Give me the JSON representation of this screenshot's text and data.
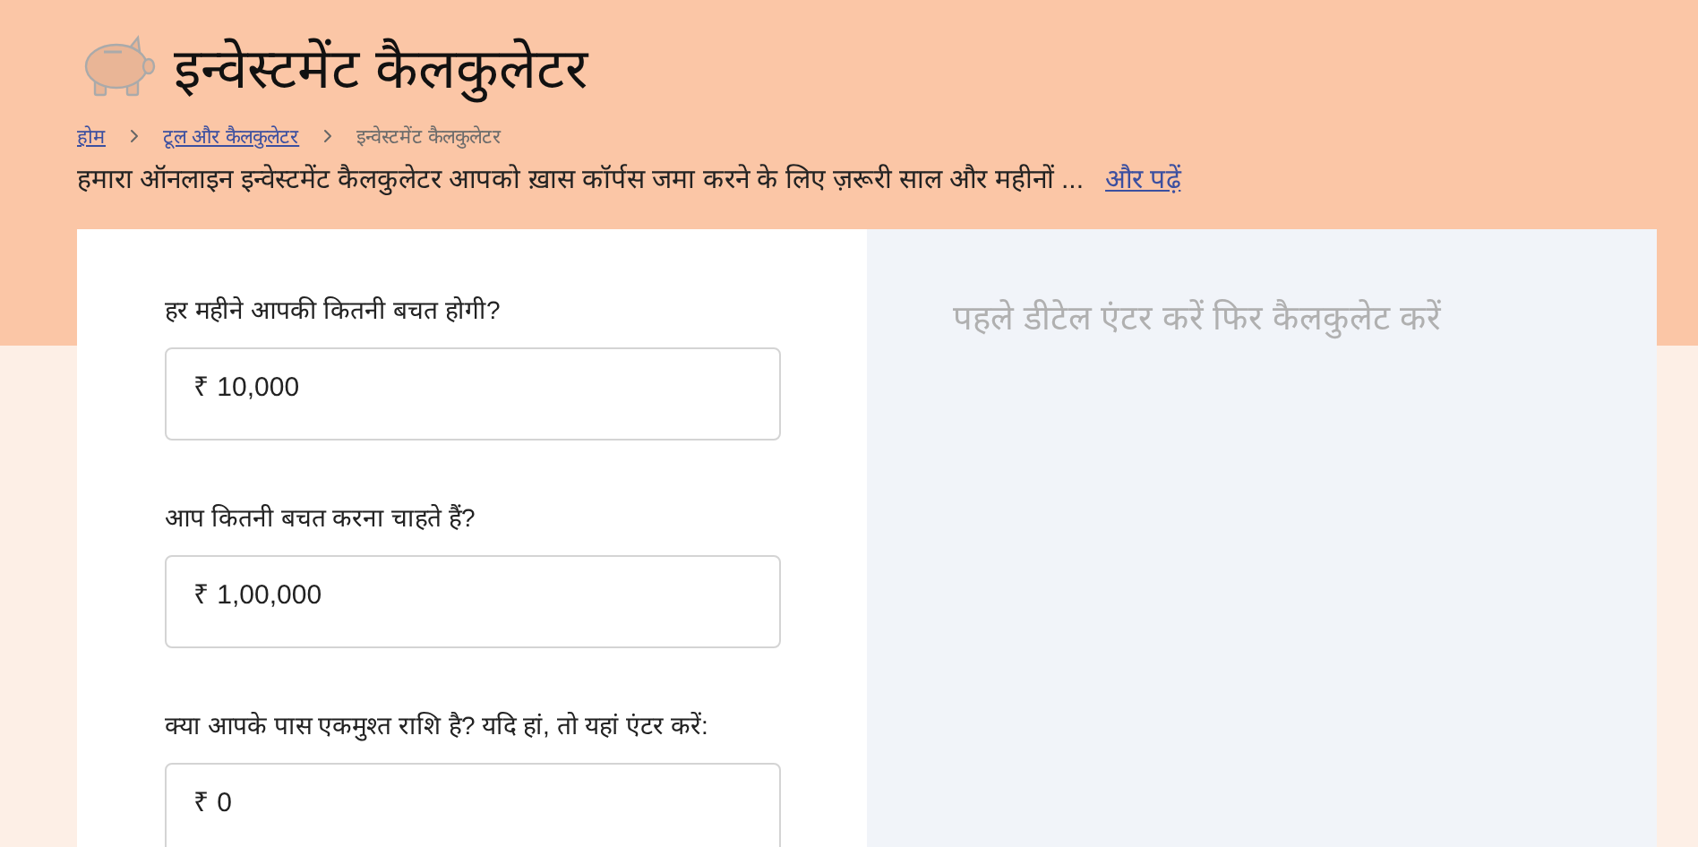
{
  "header": {
    "title": "इन्वेस्टमेंट कैलकुलेटर",
    "breadcrumb": [
      {
        "label": "होम",
        "kind": "link"
      },
      {
        "label": "टूल और कैलकुलेटर",
        "kind": "link"
      },
      {
        "label": "इन्वेस्टमेंट कैलकुलेटर",
        "kind": "current"
      }
    ],
    "description": "हमारा ऑनलाइन इन्वेस्टमेंट कैलकुलेटर आपको ख़ास कॉर्पस जमा करने के लिए ज़रूरी साल और महीनों ...",
    "read_more": "और पढ़ें"
  },
  "form": {
    "fields": [
      {
        "label": "हर महीने आपकी कितनी बचत होगी?",
        "value": "₹ 10,000"
      },
      {
        "label": "आप कितनी बचत करना चाहते हैं?",
        "value": "₹ 1,00,000"
      },
      {
        "label": "क्या आपके पास एकमुश्त राशि है? यदि हां, तो यहां एंटर करें:",
        "value": "₹ 0"
      }
    ]
  },
  "result": {
    "message": "पहले डीटेल एंटर करें फिर कैलकुलेट करें"
  }
}
